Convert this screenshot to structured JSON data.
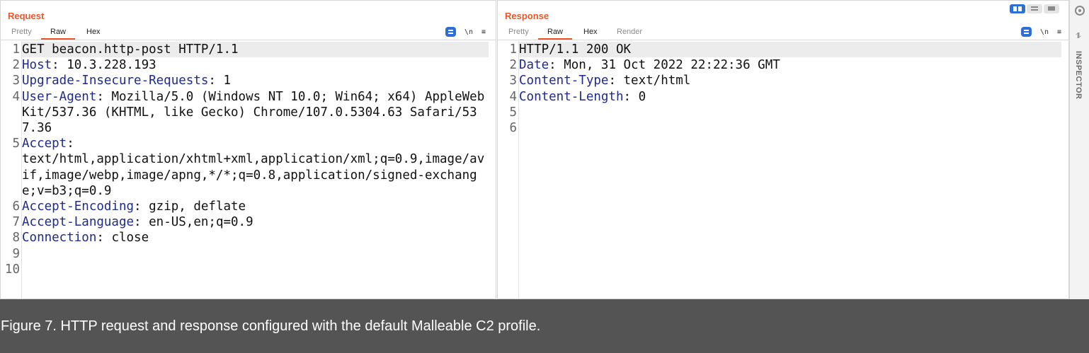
{
  "request": {
    "title": "Request",
    "tabs": [
      "Pretty",
      "Raw",
      "Hex"
    ],
    "active_tab": "Raw",
    "tool_icons": [
      "wrap-icon",
      "newline-icon",
      "menu-icon"
    ],
    "tool_labels": {
      "newline": "\\n",
      "menu": "≡"
    },
    "lines": [
      {
        "num": "1",
        "key": "",
        "sep": "",
        "value": "GET beacon.http-post HTTP/1.1"
      },
      {
        "num": "2",
        "key": "Host",
        "sep": ": ",
        "value": "10.3.228.193"
      },
      {
        "num": "3",
        "key": "Upgrade-Insecure-Requests",
        "sep": ": ",
        "value": "1"
      },
      {
        "num": "4",
        "key": "User-Agent",
        "sep": ": ",
        "value": "Mozilla/5.0 (Windows NT 10.0; Win64; x64) AppleWebKit/537.36 (KHTML, like Gecko) Chrome/107.0.5304.63 Safari/537.36"
      },
      {
        "num": "5",
        "key": "Accept",
        "sep": ":",
        "value": "text/html,application/xhtml+xml,application/xml;q=0.9,image/avif,image/webp,image/apng,*/*;q=0.8,application/signed-exchange;v=b3;q=0.9"
      },
      {
        "num": "6",
        "key": "Accept-Encoding",
        "sep": ": ",
        "value": "gzip, deflate"
      },
      {
        "num": "7",
        "key": "Accept-Language",
        "sep": ": ",
        "value": "en-US,en;q=0.9"
      },
      {
        "num": "8",
        "key": "Connection",
        "sep": ": ",
        "value": "close"
      },
      {
        "num": "9",
        "key": "",
        "sep": "",
        "value": ""
      },
      {
        "num": "10",
        "key": "",
        "sep": "",
        "value": ""
      }
    ]
  },
  "response": {
    "title": "Response",
    "tabs": [
      "Pretty",
      "Raw",
      "Hex",
      "Render"
    ],
    "active_tab": "Raw",
    "tool_icons": [
      "wrap-icon",
      "newline-icon",
      "menu-icon"
    ],
    "tool_labels": {
      "newline": "\\n",
      "menu": "≡"
    },
    "lines": [
      {
        "num": "1",
        "key": "",
        "sep": "",
        "value": "HTTP/1.1 200 OK"
      },
      {
        "num": "2",
        "key": "Date",
        "sep": ": ",
        "value": "Mon, 31 Oct 2022 22:22:36 GMT"
      },
      {
        "num": "3",
        "key": "Content-Type",
        "sep": ": ",
        "value": "text/html"
      },
      {
        "num": "4",
        "key": "Content-Length",
        "sep": ": ",
        "value": "0"
      },
      {
        "num": "5",
        "key": "",
        "sep": "",
        "value": ""
      },
      {
        "num": "6",
        "key": "",
        "sep": "",
        "value": ""
      }
    ]
  },
  "inspector": {
    "label": "INSPECTOR",
    "icons": [
      "gear-icon",
      "list-icon"
    ],
    "list_glyph": "⥮"
  },
  "layout_toggle": [
    "split-vertical-icon",
    "split-horizontal-icon",
    "tabs-icon"
  ],
  "caption": "Figure 7. HTTP request and response configured with the default Malleable C2 profile.",
  "colors": {
    "accent": "#e8572a",
    "key": "#1e2a8c",
    "button": "#2c6fd6",
    "caption_bg": "#545454"
  }
}
